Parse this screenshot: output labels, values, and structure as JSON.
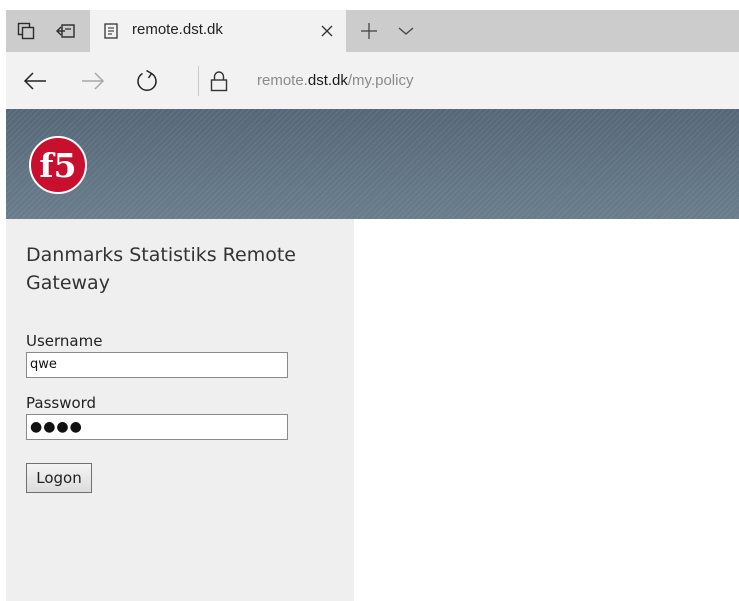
{
  "browser": {
    "tab": {
      "title": "remote.dst.dk"
    },
    "address": {
      "subdomain": "remote.",
      "domain": "dst.dk",
      "path": "/my.policy"
    },
    "icons": {
      "tab_preview": "tab-preview-icon",
      "set_aside_tabs": "set-aside-tabs-icon",
      "page": "page-icon",
      "close": "close-icon",
      "new_tab": "plus-icon",
      "tab_list": "chevron-down-icon",
      "back": "back-arrow-icon",
      "forward": "forward-arrow-icon",
      "refresh": "refresh-icon",
      "lock": "lock-icon"
    }
  },
  "page": {
    "logo_text": "f5",
    "title": "Danmarks Statistiks Remote Gateway",
    "username": {
      "label": "Username",
      "value": "qwe"
    },
    "password": {
      "label": "Password",
      "masked_value": "●●●●"
    },
    "logon_button": "Logon"
  },
  "colors": {
    "banner": "#5f7282",
    "panel": "#efefef",
    "logo_red": "#c8102e",
    "tabbar": "#cccccc",
    "toolbar": "#f2f2f2"
  }
}
